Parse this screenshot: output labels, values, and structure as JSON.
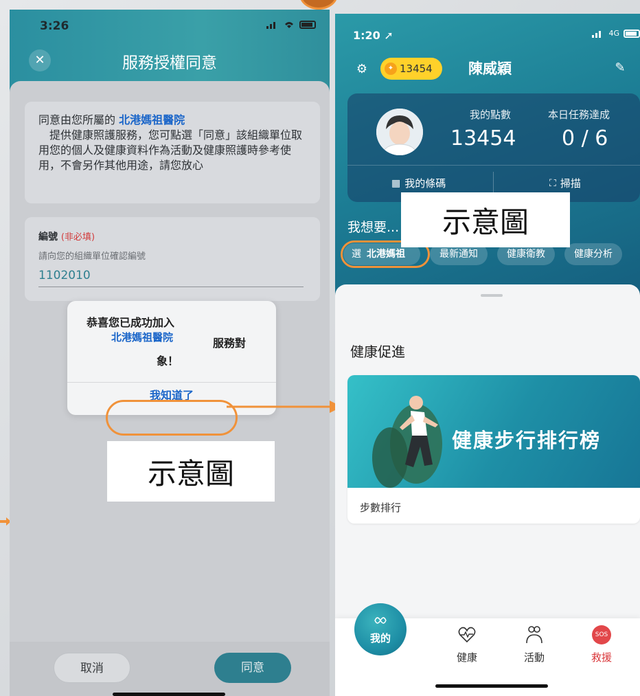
{
  "left_screen": {
    "time": "3:26",
    "title": "服務授權同意",
    "close_icon": "close-icon",
    "consent": {
      "prefix": "同意由您所屬的",
      "hospital": "北港媽祖醫院",
      "body": "　提供健康照護服務，您可點選「同意」該組織單位取用您的個人及健康資料作為活動及健康照護時參考使用，不會另作其他用途，請您放心"
    },
    "id_field": {
      "label": "編號",
      "optional": "(非必填)",
      "hint": "請向您的組織單位確認編號",
      "value": "1102010"
    },
    "dialog": {
      "line1": "恭喜您已成功加入",
      "hospital": "北港媽祖醫院",
      "service": "服務對",
      "end": "象！",
      "button": "我知道了"
    },
    "demo_label": "示意圖",
    "cancel": "取消",
    "agree": "同意"
  },
  "right_screen": {
    "time": "1:20",
    "network": "4G",
    "points_pill": "13454",
    "user_name": "陳威穎",
    "stats": {
      "points_label": "我的點數",
      "points_value": "13454",
      "task_label": "本日任務達成",
      "task_value": "0 / 6",
      "barcode": "我的條碼",
      "scan": "掃描"
    },
    "want_label": "我想要...",
    "demo_label": "示意圖",
    "chips": {
      "first_prefix": "選",
      "first_hospital": "北港媽祖",
      "items": [
        "最新通知",
        "健康衛教",
        "健康分析"
      ]
    },
    "section_title": "健康促進",
    "promo": {
      "title": "健康步行排行榜",
      "subtitle": "步數排行"
    },
    "tabs": {
      "mine": "我的",
      "health": "健康",
      "activity": "活動",
      "rescue": "救援",
      "sos": "SOS"
    }
  },
  "colors": {
    "accent_orange": "#f0923a",
    "teal": "#2e7f8f",
    "link_blue": "#1b66c9",
    "points_yellow": "#ffd12a",
    "rescue_red": "#d9383b"
  }
}
